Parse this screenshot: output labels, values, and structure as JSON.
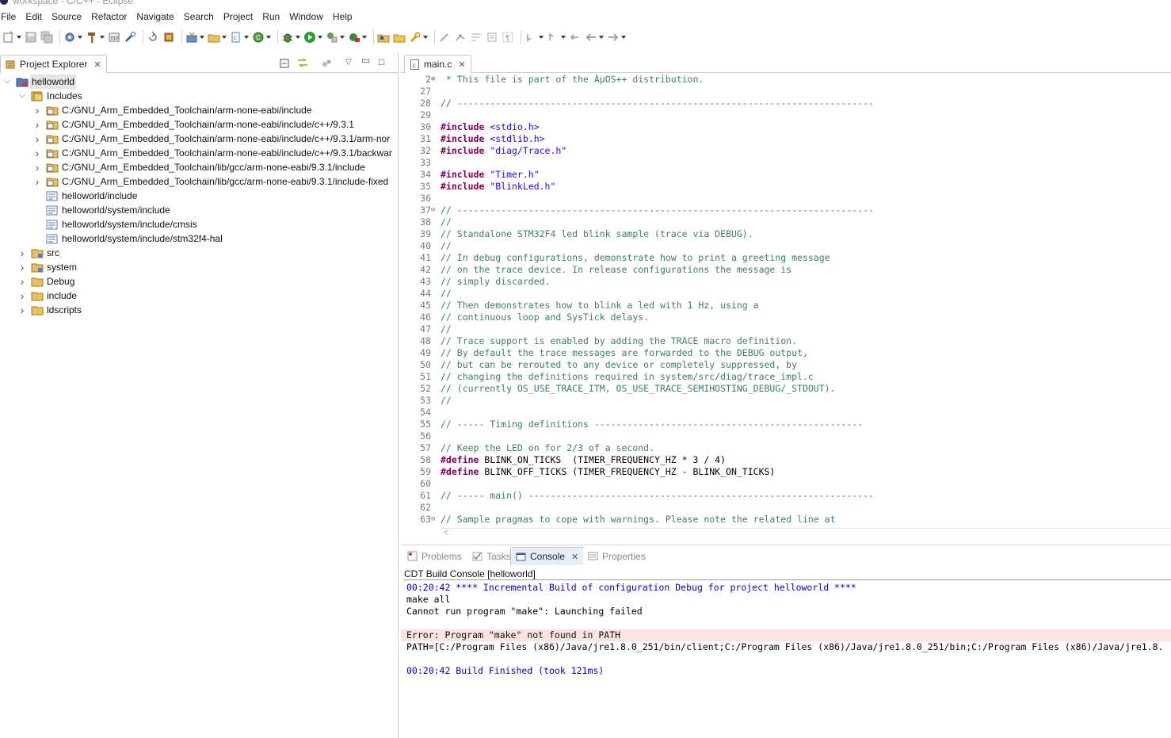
{
  "window": {
    "title": "workspace - C/C++ - Eclipse"
  },
  "menu": [
    "File",
    "Edit",
    "Source",
    "Refactor",
    "Navigate",
    "Search",
    "Project",
    "Run",
    "Window",
    "Help"
  ],
  "project_explorer": {
    "tab_label": "Project Explorer",
    "tree": [
      {
        "label": "helloworld",
        "depth": 0,
        "icon": "project-icon",
        "expanded": true,
        "selected": true
      },
      {
        "label": "Includes",
        "depth": 1,
        "icon": "includes-icon",
        "expanded": true
      },
      {
        "label": "C:/GNU_Arm_Embedded_Toolchain/arm-none-eabi/include",
        "depth": 2,
        "icon": "include-folder-icon",
        "expandable": true
      },
      {
        "label": "C:/GNU_Arm_Embedded_Toolchain/arm-none-eabi/include/c++/9.3.1",
        "depth": 2,
        "icon": "include-folder-icon",
        "expandable": true
      },
      {
        "label": "C:/GNU_Arm_Embedded_Toolchain/arm-none-eabi/include/c++/9.3.1/arm-nor",
        "depth": 2,
        "icon": "include-folder-icon",
        "expandable": true
      },
      {
        "label": "C:/GNU_Arm_Embedded_Toolchain/arm-none-eabi/include/c++/9.3.1/backwar",
        "depth": 2,
        "icon": "include-folder-icon",
        "expandable": true
      },
      {
        "label": "C:/GNU_Arm_Embedded_Toolchain/lib/gcc/arm-none-eabi/9.3.1/include",
        "depth": 2,
        "icon": "include-folder-icon",
        "expandable": true
      },
      {
        "label": "C:/GNU_Arm_Embedded_Toolchain/lib/gcc/arm-none-eabi/9.3.1/include-fixed",
        "depth": 2,
        "icon": "include-folder-icon",
        "expandable": true
      },
      {
        "label": "helloworld/include",
        "depth": 2,
        "icon": "project-include-icon",
        "expandable": false
      },
      {
        "label": "helloworld/system/include",
        "depth": 2,
        "icon": "project-include-icon",
        "expandable": false
      },
      {
        "label": "helloworld/system/include/cmsis",
        "depth": 2,
        "icon": "project-include-icon",
        "expandable": false
      },
      {
        "label": "helloworld/system/include/stm32f4-hal",
        "depth": 2,
        "icon": "project-include-icon",
        "expandable": false
      },
      {
        "label": "src",
        "depth": 1,
        "icon": "source-folder-icon",
        "expandable": true
      },
      {
        "label": "system",
        "depth": 1,
        "icon": "source-folder-icon",
        "expandable": true
      },
      {
        "label": "Debug",
        "depth": 1,
        "icon": "folder-icon",
        "expandable": true
      },
      {
        "label": "include",
        "depth": 1,
        "icon": "folder-icon",
        "expandable": true
      },
      {
        "label": "ldscripts",
        "depth": 1,
        "icon": "folder-icon",
        "expandable": true
      }
    ]
  },
  "editor": {
    "tab_label": "main.c",
    "lines": [
      {
        "n": "2",
        "fold": "plus",
        "t": "cm",
        "text": " * This file is part of the ÂµOS++ distribution."
      },
      {
        "n": "27",
        "t": "",
        "text": ""
      },
      {
        "n": "28",
        "t": "cm",
        "text": "// ----------------------------------------------------------------------------"
      },
      {
        "n": "29",
        "t": "",
        "text": ""
      },
      {
        "n": "30",
        "t": "inc",
        "kw": "#include",
        "rest": " <stdio.h>"
      },
      {
        "n": "31",
        "t": "inc",
        "kw": "#include",
        "rest": " <stdlib.h>"
      },
      {
        "n": "32",
        "t": "inc",
        "kw": "#include",
        "rest": " \"diag/Trace.h\""
      },
      {
        "n": "33",
        "t": "",
        "text": ""
      },
      {
        "n": "34",
        "t": "inc",
        "kw": "#include",
        "rest": " \"Timer.h\""
      },
      {
        "n": "35",
        "t": "inc",
        "kw": "#include",
        "rest": " \"BlinkLed.h\""
      },
      {
        "n": "36",
        "t": "",
        "text": ""
      },
      {
        "n": "37",
        "fold": "minus",
        "t": "cm",
        "text": "// ----------------------------------------------------------------------------"
      },
      {
        "n": "38",
        "t": "cm",
        "text": "//"
      },
      {
        "n": "39",
        "t": "cm",
        "text": "// Standalone STM32F4 led blink sample (trace via DEBUG)."
      },
      {
        "n": "40",
        "t": "cm",
        "text": "//"
      },
      {
        "n": "41",
        "t": "cm",
        "text": "// In debug configurations, demonstrate how to print a greeting message"
      },
      {
        "n": "42",
        "t": "cm",
        "text": "// on the trace device. In release configurations the message is"
      },
      {
        "n": "43",
        "t": "cm",
        "text": "// simply discarded."
      },
      {
        "n": "44",
        "t": "cm",
        "text": "//"
      },
      {
        "n": "45",
        "t": "cm",
        "text": "// Then demonstrates how to blink a led with 1 Hz, using a"
      },
      {
        "n": "46",
        "t": "cm",
        "text": "// continuous loop and SysTick delays."
      },
      {
        "n": "47",
        "t": "cm",
        "text": "//"
      },
      {
        "n": "48",
        "t": "cm",
        "text": "// Trace support is enabled by adding the TRACE macro definition."
      },
      {
        "n": "49",
        "t": "cm",
        "text": "// By default the trace messages are forwarded to the DEBUG output,"
      },
      {
        "n": "50",
        "t": "cm",
        "text": "// but can be rerouted to any device or completely suppressed, by"
      },
      {
        "n": "51",
        "t": "cm",
        "text": "// changing the definitions required in system/src/diag/trace_impl.c"
      },
      {
        "n": "52",
        "t": "cm",
        "text": "// (currently OS_USE_TRACE_ITM, OS_USE_TRACE_SEMIHOSTING_DEBUG/_STDOUT)."
      },
      {
        "n": "53",
        "t": "cm",
        "text": "//"
      },
      {
        "n": "54",
        "t": "",
        "text": ""
      },
      {
        "n": "55",
        "t": "cm",
        "text": "// ----- Timing definitions -------------------------------------------------"
      },
      {
        "n": "56",
        "t": "",
        "text": ""
      },
      {
        "n": "57",
        "t": "cm",
        "text": "// Keep the LED on for 2/3 of a second."
      },
      {
        "n": "58",
        "t": "inc",
        "kw": "#define",
        "rest": " BLINK_ON_TICKS  (TIMER_FREQUENCY_HZ * 3 / 4)",
        "plain": true
      },
      {
        "n": "59",
        "t": "inc",
        "kw": "#define",
        "rest": " BLINK_OFF_TICKS (TIMER_FREQUENCY_HZ - BLINK_ON_TICKS)",
        "plain": true
      },
      {
        "n": "60",
        "t": "",
        "text": ""
      },
      {
        "n": "61",
        "t": "cm",
        "text": "// ----- main() ---------------------------------------------------------------"
      },
      {
        "n": "62",
        "t": "",
        "text": ""
      },
      {
        "n": "63",
        "fold": "minus",
        "t": "cm",
        "text": "// Sample pragmas to cope with warnings. Please note the related line at"
      }
    ]
  },
  "bottom": {
    "tabs": [
      {
        "label": "Problems",
        "icon": "problems-icon",
        "active": false
      },
      {
        "label": "Tasks",
        "icon": "tasks-icon",
        "active": false
      },
      {
        "label": "Console",
        "icon": "console-icon",
        "active": true
      },
      {
        "label": "Properties",
        "icon": "properties-icon",
        "active": false
      }
    ],
    "console_title": "CDT Build Console [helloworld]",
    "console_lines": [
      {
        "text": "00:20:42 **** Incremental Build of configuration Debug for project helloworld ****",
        "style": "blue"
      },
      {
        "text": "make all",
        "style": ""
      },
      {
        "text": "Cannot run program \"make\": Launching failed",
        "style": ""
      },
      {
        "text": "",
        "style": ""
      },
      {
        "text": "Error: Program \"make\" not found in PATH",
        "style": "err"
      },
      {
        "text": "PATH=[C:/Program Files (x86)/Java/jre1.8.0_251/bin/client;C:/Program Files (x86)/Java/jre1.8.0_251/bin;C:/Program Files (x86)/Java/jre1.8.",
        "style": ""
      },
      {
        "text": "",
        "style": ""
      },
      {
        "text": "00:20:42 Build Finished (took 121ms)",
        "style": "blue"
      }
    ]
  }
}
